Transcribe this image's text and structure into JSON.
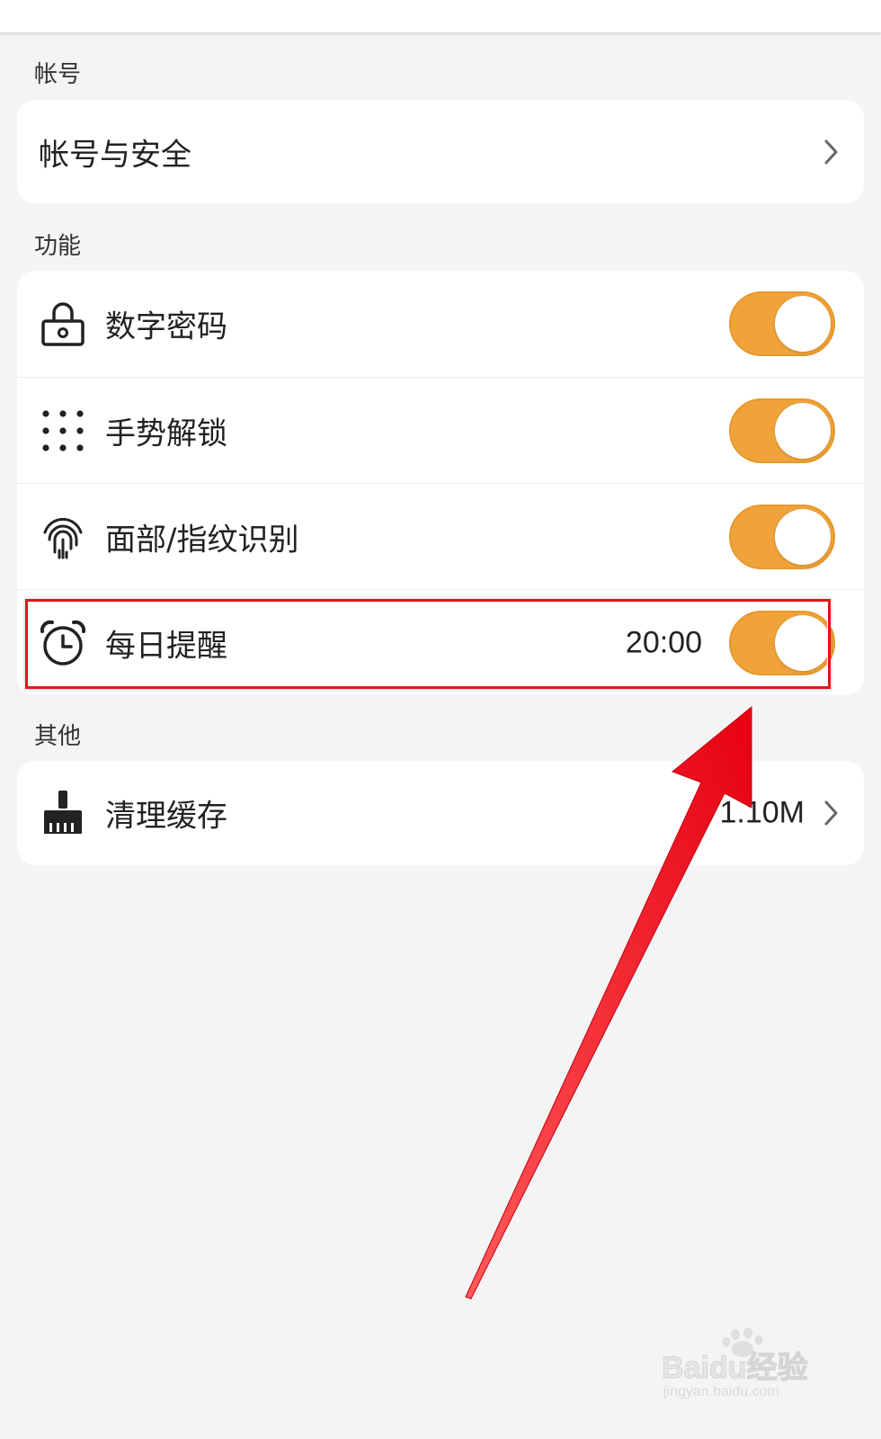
{
  "sections": {
    "account": {
      "title": "帐号",
      "items": [
        {
          "label": "帐号与安全"
        }
      ]
    },
    "features": {
      "title": "功能",
      "items": [
        {
          "label": "数字密码",
          "icon": "lock-icon",
          "toggle_on": true
        },
        {
          "label": "手势解锁",
          "icon": "dot-grid-icon",
          "toggle_on": true
        },
        {
          "label": "面部/指纹识别",
          "icon": "fingerprint-icon",
          "toggle_on": true
        },
        {
          "label": "每日提醒",
          "icon": "alarm-clock-icon",
          "value": "20:00",
          "toggle_on": true
        }
      ]
    },
    "other": {
      "title": "其他",
      "items": [
        {
          "label": "清理缓存",
          "icon": "broom-icon",
          "value": "1.10M"
        }
      ]
    }
  },
  "colors": {
    "toggle_on": "#f0a33a",
    "highlight": "#e8121a",
    "arrow": "#e60012"
  },
  "watermark": {
    "line1": "Baidu经验",
    "line2": "jingyan.baidu.com"
  }
}
